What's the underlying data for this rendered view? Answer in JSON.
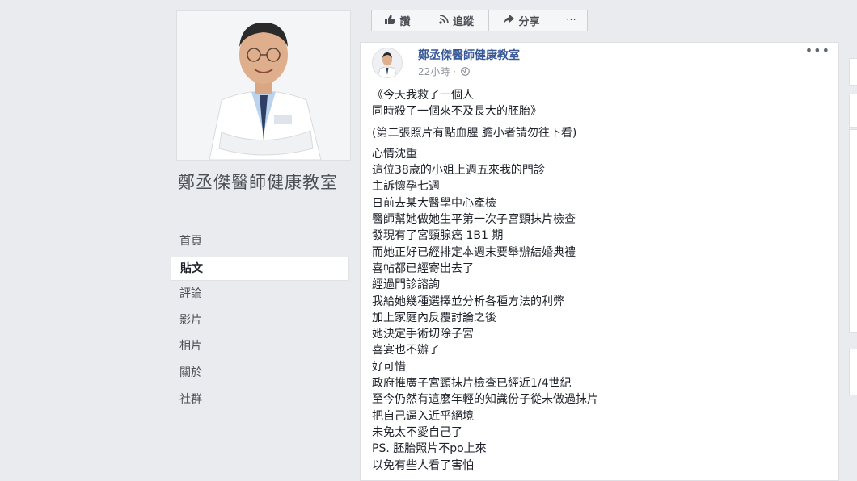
{
  "sidebar": {
    "page_name": "鄭丞傑醫師健康教室",
    "nav": [
      {
        "label": "首頁",
        "active": false
      },
      {
        "label": "貼文",
        "active": true
      },
      {
        "label": "評論",
        "active": false
      },
      {
        "label": "影片",
        "active": false
      },
      {
        "label": "相片",
        "active": false
      },
      {
        "label": "關於",
        "active": false
      },
      {
        "label": "社群",
        "active": false
      }
    ]
  },
  "actions": {
    "like_label": "讚",
    "follow_label": "追蹤",
    "share_label": "分享",
    "more_label": "···"
  },
  "post": {
    "author": "鄭丞傑醫師健康教室",
    "time": "22小時 ·",
    "more": "•••",
    "lines": [
      "《今天我救了一個人",
      "同時殺了一個來不及長大的胚胎》",
      "",
      "(第二張照片有點血腥 膽小者請勿往下看)",
      "",
      "心情沈重",
      "這位38歲的小姐上週五來我的門診",
      "主訴懷孕七週",
      "日前去某大醫學中心產檢",
      "醫師幫她做她生平第一次子宮頸抹片檢查",
      "發現有了宮頸腺癌 1B1 期",
      "而她正好已經排定本週末要舉辦結婚典禮",
      "喜帖都已經寄出去了",
      "經過門診諮詢",
      "我給她幾種選擇並分析各種方法的利弊",
      "加上家庭內反覆討論之後",
      "她決定手術切除子宮",
      "喜宴也不辦了",
      "好可惜",
      "政府推廣子宮頸抹片檢查已經近1/4世紀",
      "至今仍然有這麼年輕的知識份子從未做過抹片",
      "把自己逼入近乎絕境",
      "未免太不愛自己了",
      "PS. 胚胎照片不po上來",
      "以免有些人看了害怕"
    ]
  }
}
